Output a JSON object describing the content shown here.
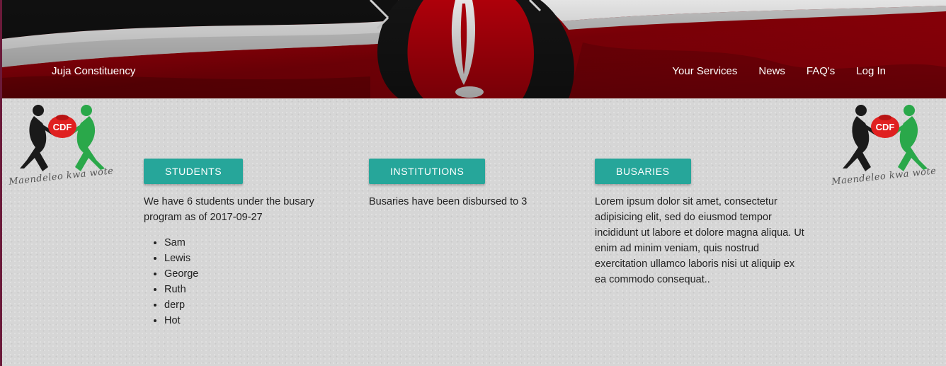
{
  "header": {
    "brand": "Juja Constituency",
    "nav": [
      "Your Services",
      "News",
      "FAQ's",
      "Log In"
    ]
  },
  "logo": {
    "badge_text": "CDF",
    "motto": "Maendeleo kwa wote"
  },
  "students": {
    "button_label": "STUDENTS",
    "summary": "We have 6 students under the busary program as of 2017-09-27",
    "names": [
      "Sam",
      "Lewis",
      "George",
      "Ruth",
      "derp",
      "Hot"
    ]
  },
  "institutions": {
    "button_label": "INSTITUTIONS",
    "summary": "Busaries have been disbursed to 3"
  },
  "busaries": {
    "button_label": "BUSARIES",
    "text": "Lorem ipsum dolor sit amet, consectetur adipisicing elit, sed do eiusmod tempor incididunt ut labore et dolore magna aliqua. Ut enim ad minim veniam, quis nostrud exercitation ullamco laboris nisi ut aliquip ex ea commodo consequat.."
  },
  "colors": {
    "accent": "#26a69a",
    "flag_red": "#b3000c",
    "flag_black": "#111111",
    "flag_green": "#0a7a2f"
  }
}
